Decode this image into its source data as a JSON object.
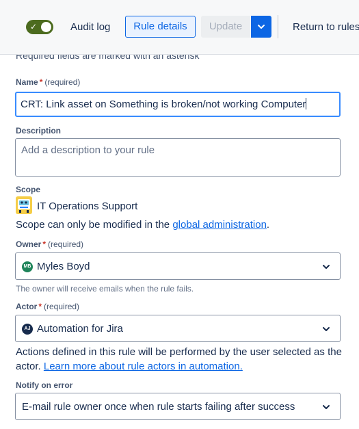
{
  "header": {
    "toggle_on": true,
    "audit_log_label": "Audit log",
    "rule_details_label": "Rule details",
    "update_label": "Update",
    "return_label": "Return to rules"
  },
  "form": {
    "required_note": "Required fields are marked with an asterisk",
    "name": {
      "label": "Name",
      "asterisk": "*",
      "required_text": "(required)",
      "value": "CRT: Link asset on Something is broken/not working Computer"
    },
    "description": {
      "label": "Description",
      "placeholder": "Add a description to your rule"
    },
    "scope": {
      "label": "Scope",
      "value": "IT Operations Support",
      "note_prefix": "Scope can only be modified in the ",
      "note_link": "global administration",
      "note_suffix": "."
    },
    "owner": {
      "label": "Owner",
      "asterisk": "*",
      "required_text": "(required)",
      "avatar_initials": "MB",
      "avatar_color": "#1f845a",
      "value": "Myles Boyd",
      "help": "The owner will receive emails when the rule fails."
    },
    "actor": {
      "label": "Actor",
      "asterisk": "*",
      "required_text": "(required)",
      "avatar_initials": "AJ",
      "avatar_color": "#172b4d",
      "value": "Automation for Jira",
      "note": "Actions defined in this rule will be performed by the user selected as the actor. ",
      "note_link": "Learn more about rule actors in automation."
    },
    "notify": {
      "label": "Notify on error",
      "value": "E-mail rule owner once when rule starts failing after success"
    }
  },
  "colors": {
    "accent": "#0c66e4",
    "toggle": "#4c6b1f",
    "required": "#c9372c"
  }
}
